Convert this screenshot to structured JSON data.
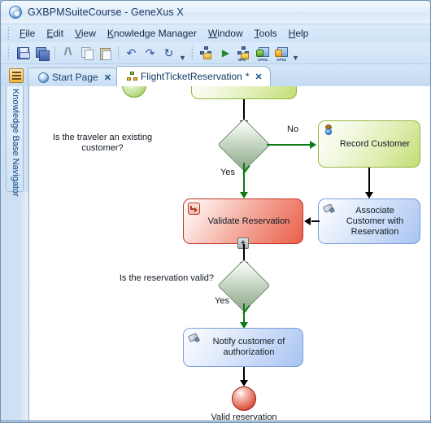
{
  "window": {
    "title": "GXBPMSuiteCourse - GeneXus X",
    "app_icon": "genexus-logo-icon"
  },
  "menu": {
    "items": [
      {
        "label": "File",
        "accel": "F"
      },
      {
        "label": "Edit",
        "accel": "E"
      },
      {
        "label": "View",
        "accel": "V"
      },
      {
        "label": "Knowledge Manager",
        "accel": "K"
      },
      {
        "label": "Window",
        "accel": "W"
      },
      {
        "label": "Tools",
        "accel": "T"
      },
      {
        "label": "Help",
        "accel": "H"
      }
    ]
  },
  "toolbar": {
    "buttons": [
      {
        "name": "save-icon",
        "tooltip": "Save"
      },
      {
        "name": "save-all-icon",
        "tooltip": "Save All"
      },
      {
        "name": "cut-icon",
        "tooltip": "Cut"
      },
      {
        "name": "copy-icon",
        "tooltip": "Copy"
      },
      {
        "name": "paste-icon",
        "tooltip": "Paste"
      },
      {
        "name": "undo-icon",
        "tooltip": "Undo"
      },
      {
        "name": "redo-icon",
        "tooltip": "Redo"
      },
      {
        "name": "redo-all-icon",
        "tooltip": "Redo All"
      },
      {
        "name": "build-process-icon",
        "tooltip": "Build Process"
      },
      {
        "name": "run-icon",
        "tooltip": "Run"
      },
      {
        "name": "import-bpd-icon",
        "tooltip": "Import BPD"
      },
      {
        "name": "import-xpdl-icon",
        "tooltip": "Import XPDL"
      },
      {
        "name": "export-xpdl-icon",
        "tooltip": "Export XPDL"
      }
    ],
    "undo_glyph": "↶",
    "redo_glyph": "↷",
    "redo_all_glyph": "↻",
    "play_glyph": "▶",
    "bpd_label": "BPD",
    "xpdl_label": "XPDL",
    "overflow_glyph": "▼"
  },
  "sidebar": {
    "toggle_name": "knowledge-base-navigator-toggle",
    "label": "Knowledge Base Navigator"
  },
  "tabs": [
    {
      "label": "Start Page",
      "icon": "start-page-icon",
      "active": false,
      "close_glyph": "✕",
      "modified": ""
    },
    {
      "label": "FlightTicketReservation",
      "icon": "diagram-icon",
      "active": true,
      "close_glyph": "✕",
      "modified": " *"
    }
  ],
  "diagram": {
    "type": "bpmn-process",
    "nodes": [
      {
        "id": "start-event",
        "kind": "start-event",
        "label": "",
        "icon": "start-event-icon"
      },
      {
        "id": "top-task",
        "kind": "task",
        "label": "",
        "icon": "",
        "color": "green"
      },
      {
        "id": "gateway-existing-customer",
        "kind": "exclusive-gateway",
        "label": "Is the traveler an existing customer?"
      },
      {
        "id": "record-customer",
        "kind": "user-task",
        "label": "Record Customer",
        "icon": "user-task-icon",
        "color": "green"
      },
      {
        "id": "associate-customer",
        "kind": "service-task",
        "label": "Associate Customer with Reservation",
        "icon": "service-task-icon",
        "color": "blue"
      },
      {
        "id": "validate-reservation",
        "kind": "call-activity",
        "label": "Validate Reservation",
        "icon": "call-activity-icon",
        "color": "red",
        "selected": true,
        "expand_marker": "+"
      },
      {
        "id": "gateway-reservation-valid",
        "kind": "exclusive-gateway",
        "label": "Is the reservation valid?"
      },
      {
        "id": "notify-customer",
        "kind": "service-task",
        "label": "Notify customer of authorization",
        "icon": "service-task-icon",
        "color": "blue"
      },
      {
        "id": "end-event",
        "kind": "end-event",
        "label": "Valid reservation",
        "icon": "end-event-icon"
      }
    ],
    "flow_labels": {
      "no": "No",
      "yes_top": "Yes",
      "yes_bottom": "Yes"
    }
  }
}
